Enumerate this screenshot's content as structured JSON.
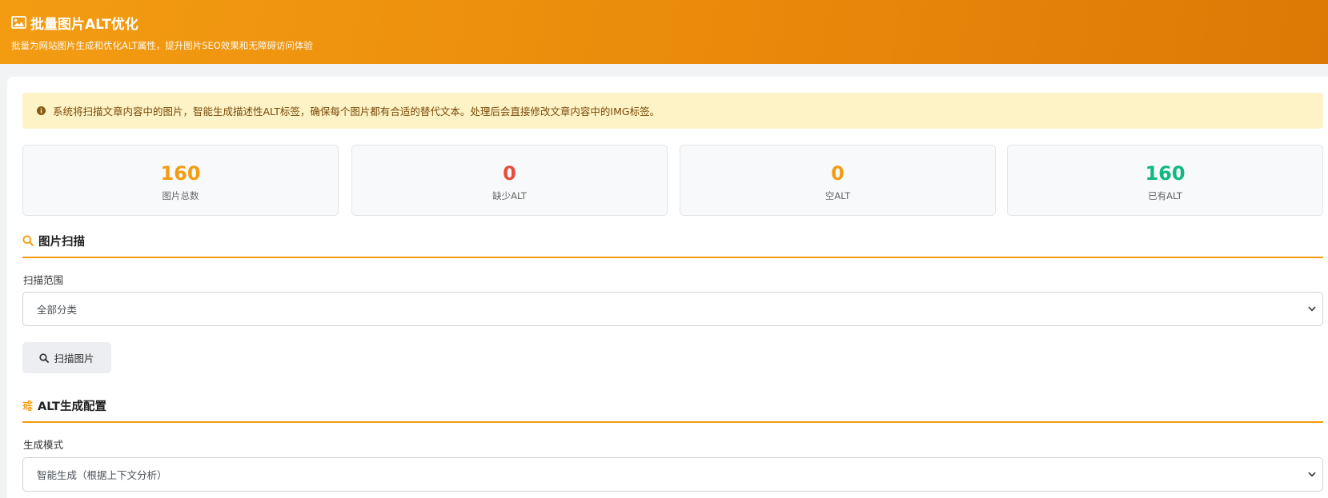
{
  "header": {
    "title": "批量图片ALT优化",
    "subtitle": "批量为网站图片生成和优化ALT属性，提升图片SEO效果和无障碍访问体验",
    "icon": "image-icon"
  },
  "notice": {
    "icon": "info-icon",
    "text": "系统将扫描文章内容中的图片，智能生成描述性ALT标签，确保每个图片都有合适的替代文本。处理后会直接修改文章内容中的IMG标签。"
  },
  "stats": [
    {
      "value": "160",
      "label": "图片总数",
      "color": "#f39c12"
    },
    {
      "value": "0",
      "label": "缺少ALT",
      "color": "#e74c3c"
    },
    {
      "value": "0",
      "label": "空ALT",
      "color": "#f39c12"
    },
    {
      "value": "160",
      "label": "已有ALT",
      "color": "#10b981"
    }
  ],
  "scan_section": {
    "title": "图片扫描",
    "icon": "search-icon",
    "range_label": "扫描范围",
    "range_value": "全部分类",
    "scan_button": "扫描图片"
  },
  "config_section": {
    "title": "ALT生成配置",
    "icon": "sliders-icon",
    "mode_label": "生成模式",
    "mode_value": "智能生成（根据上下文分析）"
  },
  "colors": {
    "accent": "#f39c12",
    "danger": "#e74c3c",
    "success": "#10b981",
    "notice_bg": "#fef3c7"
  }
}
